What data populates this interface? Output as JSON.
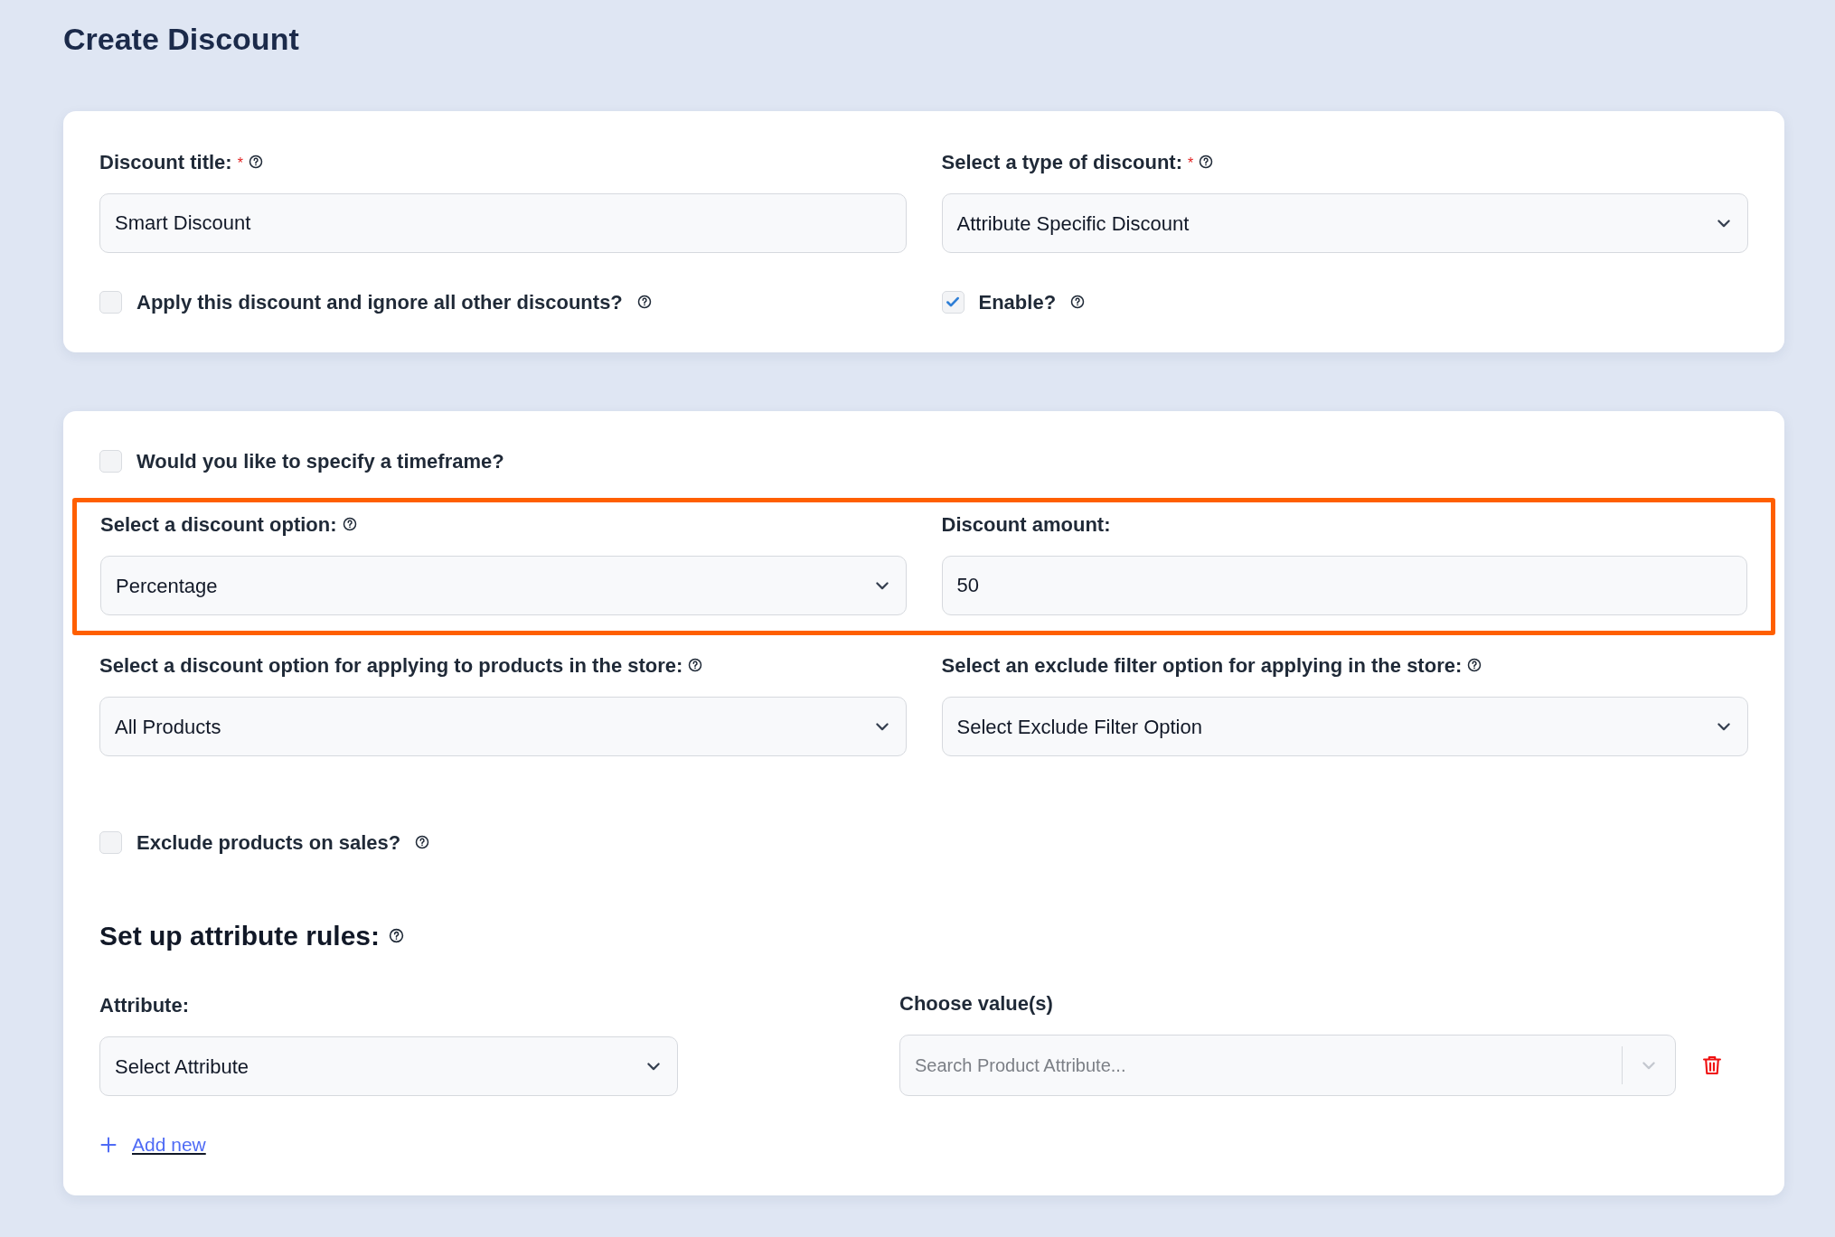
{
  "page_title": "Create Discount",
  "general_card": {
    "rows": [
      {
        "highlighted": false,
        "fields": [
          {
            "kind": "text",
            "label": "Discount title:",
            "required_mark": "*",
            "help": true,
            "value": "Smart Discount"
          },
          {
            "kind": "select",
            "label": "Select a type of discount:",
            "required_mark": "*",
            "help": true,
            "value": "Attribute Specific Discount"
          }
        ]
      }
    ],
    "checkboxes": [
      {
        "label": "Apply this discount and ignore all other discounts?",
        "checked": false,
        "help": true
      },
      {
        "label": "Enable?",
        "checked": true,
        "help": true
      }
    ]
  },
  "rules_card": {
    "timeframe_checkbox": {
      "label": "Would you like to specify a timeframe?",
      "checked": false,
      "help": false
    },
    "rows": [
      {
        "highlighted": true,
        "fields": [
          {
            "kind": "select",
            "label": "Select a discount option:",
            "help": true,
            "value": "Percentage"
          },
          {
            "kind": "text",
            "label": "Discount amount:",
            "help": false,
            "value": "50"
          }
        ]
      },
      {
        "highlighted": false,
        "fields": [
          {
            "kind": "select",
            "label": "Select a discount option for applying to products in the store:",
            "help": true,
            "value": "All Products"
          },
          {
            "kind": "select",
            "label": "Select an exclude filter option for applying in the store:",
            "help": true,
            "value": "Select Exclude Filter Option"
          }
        ]
      }
    ],
    "sale_checkbox": {
      "label": "Exclude products on sales?",
      "checked": false,
      "help": true
    },
    "attribute_rules": {
      "heading": "Set up attribute rules:",
      "help": true,
      "attribute": {
        "kind": "select",
        "label": "Attribute:",
        "help": false,
        "value": "Select Attribute"
      },
      "values": {
        "kind": "search_select",
        "label": "Choose value(s)",
        "help": false,
        "placeholder": "Search Product Attribute..."
      },
      "add_link": "Add new"
    }
  }
}
